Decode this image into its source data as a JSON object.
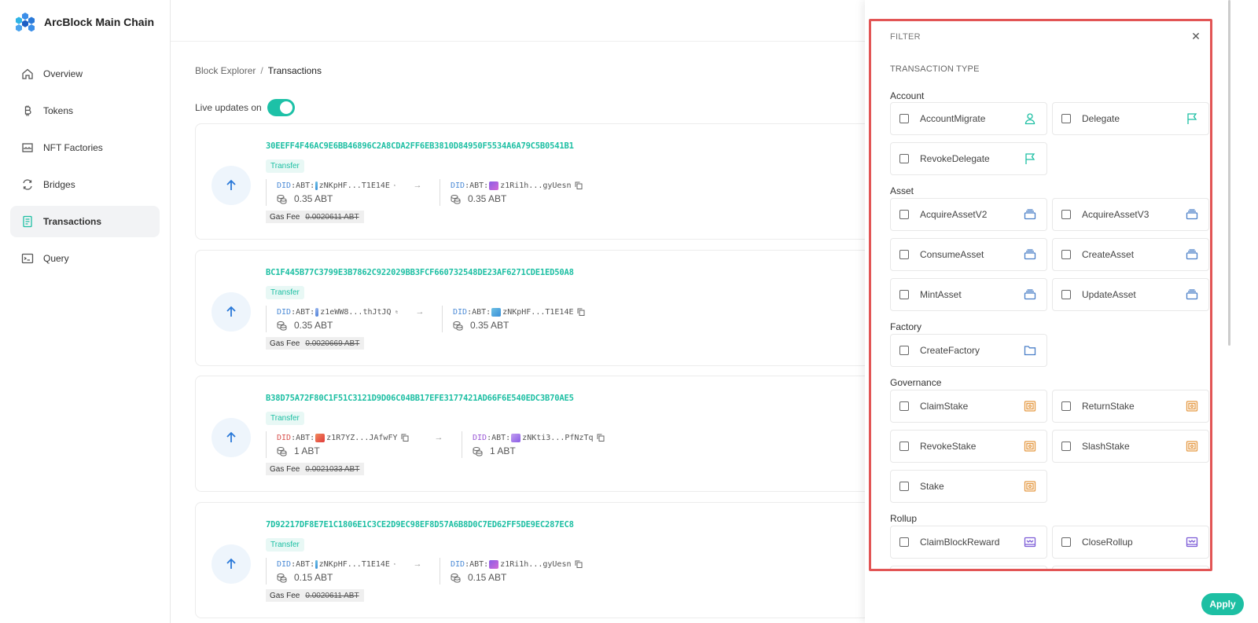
{
  "app": {
    "name": "ArcBlock Main Chain"
  },
  "sidebar": {
    "items": [
      {
        "label": "Overview",
        "icon": "home-icon"
      },
      {
        "label": "Tokens",
        "icon": "bitcoin-icon"
      },
      {
        "label": "NFT Factories",
        "icon": "factory-icon"
      },
      {
        "label": "Bridges",
        "icon": "sync-icon"
      },
      {
        "label": "Transactions",
        "icon": "receipt-icon",
        "active": true
      },
      {
        "label": "Query",
        "icon": "terminal-icon"
      }
    ]
  },
  "breadcrumb": {
    "root": "Block Explorer",
    "separator": "/",
    "current": "Transactions"
  },
  "live": {
    "label": "Live updates on",
    "enabled": true
  },
  "transactions": [
    {
      "hash": "30EEFF4F46AC9E6BB46896C2A8CDA2FF6EB3810D84950F5534A6A79C5B0541B1",
      "type": "Transfer",
      "from": {
        "prefix": "DID",
        "chain": ":ABT:",
        "addr": "zNKpHF...T1E14E",
        "amount": "0.35 ABT"
      },
      "to": {
        "prefix": "DID",
        "chain": ":ABT:",
        "addr": "z1Ri1h...gyUesn",
        "amount": "0.35 ABT"
      },
      "gas_label": "Gas Fee",
      "gas": "0.0020611 ABT"
    },
    {
      "hash": "BC1F445B77C3799E3B7862C922029BB3FCF660732548DE23AF6271CDE1ED50A8",
      "type": "Transfer",
      "from": {
        "prefix": "DID",
        "chain": ":ABT:",
        "addr": "z1eWW8...thJtJQ",
        "amount": "0.35 ABT"
      },
      "to": {
        "prefix": "DID",
        "chain": ":ABT:",
        "addr": "zNKpHF...T1E14E",
        "amount": "0.35 ABT"
      },
      "gas_label": "Gas Fee",
      "gas": "0.0020669 ABT"
    },
    {
      "hash": "B38D75A72F80C1F51C3121D9D06C04BB17EFE3177421AD66F6E540EDC3B70AE5",
      "type": "Transfer",
      "from": {
        "prefix": "DID",
        "chain": ":ABT:",
        "addr": "z1R7YZ...JAfwFY",
        "amount": "1 ABT"
      },
      "to": {
        "prefix": "DID",
        "chain": ":ABT:",
        "addr": "zNKti3...PfNzTq",
        "amount": "1 ABT"
      },
      "gas_label": "Gas Fee",
      "gas": "0.0021033 ABT"
    },
    {
      "hash": "7D92217DF8E7E1C1806E1C3CE2D9EC98EF8D57A6B8D0C7ED62FF5DE9EC287EC8",
      "type": "Transfer",
      "from": {
        "prefix": "DID",
        "chain": ":ABT:",
        "addr": "zNKpHF...T1E14E",
        "amount": "0.15 ABT"
      },
      "to": {
        "prefix": "DID",
        "chain": ":ABT:",
        "addr": "z1Ri1h...gyUesn",
        "amount": "0.15 ABT"
      },
      "gas_label": "Gas Fee",
      "gas": "0.0020611 ABT"
    }
  ],
  "filter": {
    "title": "FILTER",
    "close_icon": "close-icon",
    "section_title": "TRANSACTION TYPE",
    "groups": {
      "account": {
        "label": "Account",
        "options": [
          "AccountMigrate",
          "Delegate",
          "RevokeDelegate"
        ]
      },
      "asset": {
        "label": "Asset",
        "options": [
          "AcquireAssetV2",
          "AcquireAssetV3",
          "ConsumeAsset",
          "CreateAsset",
          "MintAsset",
          "UpdateAsset"
        ]
      },
      "factory": {
        "label": "Factory",
        "options": [
          "CreateFactory"
        ]
      },
      "governance": {
        "label": "Governance",
        "options": [
          "ClaimStake",
          "ReturnStake",
          "RevokeStake",
          "SlashStake",
          "Stake"
        ]
      },
      "rollup": {
        "label": "Rollup",
        "options": [
          "ClaimBlockReward",
          "CloseRollup"
        ]
      }
    },
    "apply_label": "Apply"
  },
  "colors": {
    "accent": "#1dbfa3",
    "highlight_border": "#e25555",
    "asset_icon": "#4a7fc8",
    "stake_icon": "#e59a45",
    "rollup_icon": "#7c5cd6"
  }
}
